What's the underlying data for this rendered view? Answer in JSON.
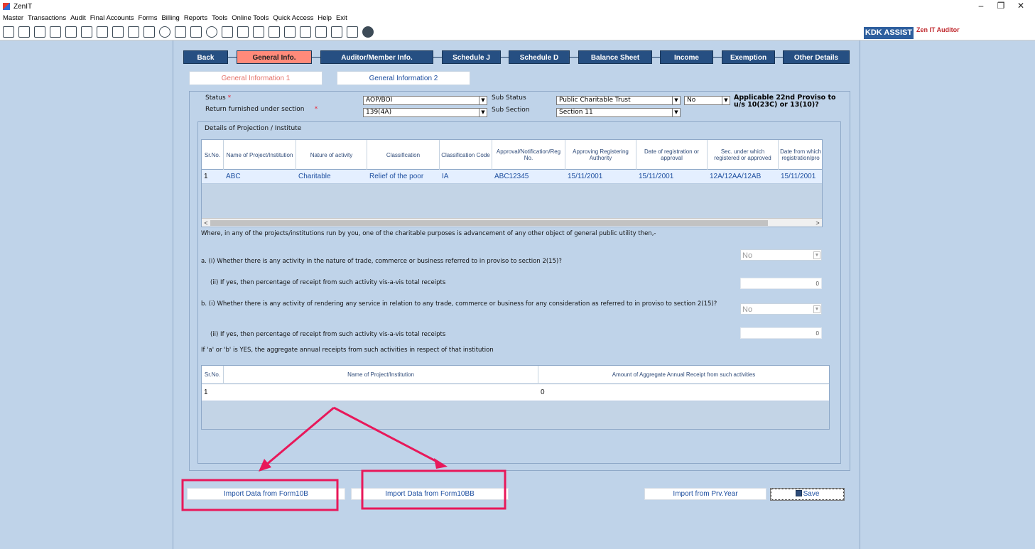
{
  "window": {
    "title": "ZenIT",
    "minimize": "–",
    "restore": "❐",
    "close": "✕"
  },
  "menu": [
    "Master",
    "Transactions",
    "Audit",
    "Final Accounts",
    "Forms",
    "Billing",
    "Reports",
    "Tools",
    "Online Tools",
    "Quick Access",
    "Help",
    "Exit"
  ],
  "toolbar": {
    "kdk_assist": "KDK ASSIST",
    "brand": "Zen IT Auditor"
  },
  "nav_tabs": [
    "Back",
    "General Info.",
    "Auditor/Member Info.",
    "Schedule J",
    "Schedule D",
    "Balance Sheet",
    "Income",
    "Exemption",
    "Other Details"
  ],
  "sub_tabs": [
    "General Information 1",
    "General Information 2"
  ],
  "form": {
    "status_label": "Status",
    "status_value": "AOP/BOI",
    "return_label": "Return furnished under section",
    "return_value": "139(4A)",
    "sub_status_label": "Sub Status",
    "sub_status_value": "Public Charitable Trust",
    "sub_section_label": "Sub Section",
    "sub_section_value": "Section 11",
    "proviso_value": "No",
    "proviso_note_1": "Applicable 22nd Proviso to",
    "proviso_note_2": "u/s 10(23C) or 13(10)?",
    "required_mark": "*"
  },
  "projection": {
    "title": "Details of Projection / Institute",
    "columns": [
      "Sr.No.",
      "Name of Project/Institution",
      "Nature of activity",
      "Classification",
      "Classification Code",
      "Approval/Notification/Reg No.",
      "Approving Registering Authority",
      "Date of registration or approval",
      "Sec. under which registered or approved",
      "Date from which registration/pro"
    ],
    "row": [
      "1",
      "ABC",
      "Charitable",
      "Relief of the poor",
      "IA",
      "ABC12345",
      "15/11/2001",
      "15/11/2001",
      "12A/12AA/12AB",
      "15/11/2001"
    ],
    "scroll_left": "<",
    "scroll_right": ">"
  },
  "questions": {
    "intro": "Where, in any of the projects/institutions run by you, one of the charitable purposes is advancement of any other object of general public utility then,-",
    "a1": "a. (i) Whether there is any activity in the nature of trade, commerce or business referred to in proviso to section 2(15)?",
    "a1_value": "No",
    "a2": "(ii) If yes, then percentage of receipt from such activity vis-a-vis total receipts",
    "a2_value": "0",
    "b1": "b. (i) Whether there is any activity of rendering any service in relation to any trade, commerce or business for any consideration as referred to in proviso to section 2(15)?",
    "b1_value": "No",
    "b2": "(ii) If yes, then percentage of receipt from such activity vis-a-vis total receipts",
    "b2_value": "0",
    "aggregate": "If 'a' or 'b' is YES, the aggregate annual receipts from such activities in respect of that institution"
  },
  "aggregate_grid": {
    "columns": [
      "Sr.No.",
      "Name of Project/Institution",
      "Amount of Aggregate Annual Receipt from such activities"
    ],
    "row": [
      "1",
      "",
      "0"
    ]
  },
  "buttons": {
    "import_10b": "Import Data from Form10B",
    "import_10bb": "Import Data from Form10BB",
    "import_prev": "Import from Prv.Year",
    "save": "Save"
  },
  "colors": {
    "nav": "#264f82",
    "active_tab": "#ff8a7a",
    "annotation": "#e8185a",
    "panel": "#bfd3e9"
  }
}
